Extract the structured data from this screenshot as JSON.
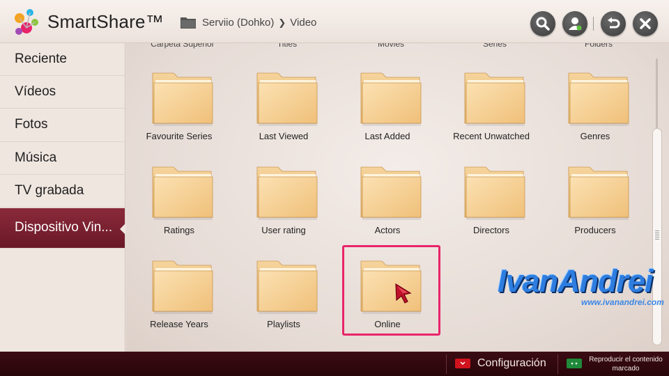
{
  "header": {
    "app_title": "SmartShare™",
    "breadcrumb": {
      "source": "Serviio (Dohko)",
      "separator": "❯",
      "current": "Video"
    },
    "buttons": [
      {
        "name": "search-icon"
      },
      {
        "name": "user-icon"
      },
      {
        "name": "back-icon"
      },
      {
        "name": "close-icon"
      }
    ]
  },
  "sidebar": {
    "items": [
      {
        "label": "Reciente"
      },
      {
        "label": "Vídeos"
      },
      {
        "label": "Fotos"
      },
      {
        "label": "Música"
      },
      {
        "label": "TV grabada"
      },
      {
        "label": "Dispositivo Vin...",
        "active": true
      }
    ]
  },
  "grid": {
    "partial_row": [
      "Carpeta Superior",
      "Titles",
      "Movies",
      "Series",
      "Folders"
    ],
    "folders": [
      {
        "label": "Favourite Series"
      },
      {
        "label": "Last Viewed"
      },
      {
        "label": "Last Added"
      },
      {
        "label": "Recent Unwatched"
      },
      {
        "label": "Genres"
      },
      {
        "label": "Ratings"
      },
      {
        "label": "User rating"
      },
      {
        "label": "Actors"
      },
      {
        "label": "Directors"
      },
      {
        "label": "Producers"
      },
      {
        "label": "Release Years"
      },
      {
        "label": "Playlists"
      },
      {
        "label": "Online",
        "selected": true
      }
    ]
  },
  "watermark": {
    "name": "IvanAndrei",
    "url": "www.ivanandrei.com"
  },
  "footer": {
    "settings_label": "Configuración",
    "play_marked_line1": "Reproducir el contenido",
    "play_marked_line2": "marcado",
    "red_button_color": "#d0131d",
    "green_button_color": "#1f8a3a"
  },
  "colors": {
    "accent": "#7a2233",
    "highlight_border": "#e8246a",
    "folder": "#f2c98a"
  }
}
